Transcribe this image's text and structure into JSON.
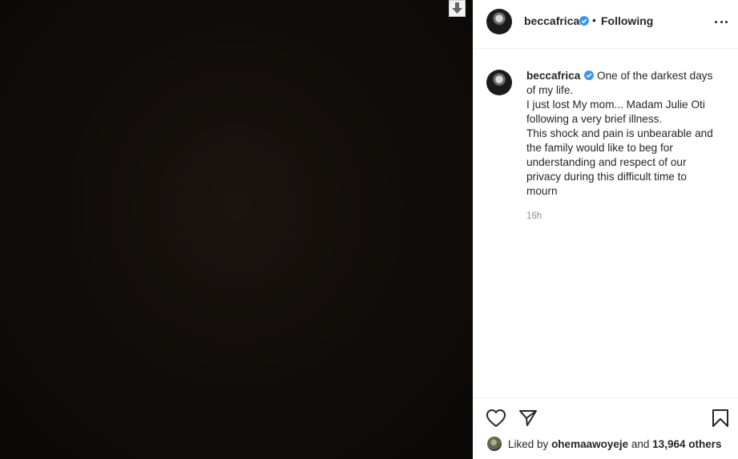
{
  "post": {
    "username": "beccafrica",
    "separator": "•",
    "follow_status": "Following",
    "caption_lines": [
      "One of the darkest days",
      "of my life.",
      "I just lost My mom... Madam Julie Oti",
      "following a very brief illness.",
      "This shock and pain is unbearable and",
      "the family would like to beg for",
      "understanding and respect of our",
      "privacy during this difficult time to",
      "mourn"
    ],
    "time_ago": "16h",
    "liked_prefix": "Liked by",
    "liked_user": "ohemaawoyeje",
    "liked_and": "and",
    "liked_others": "13,964 others"
  },
  "icons": {
    "download": "download-arrow-icon",
    "verified": "verified-badge-icon",
    "more": "more-options-icon",
    "like": "heart-icon",
    "share": "paper-plane-icon",
    "save": "bookmark-icon"
  },
  "colors": {
    "verified_blue": "#3897f0",
    "text": "#262626",
    "muted": "#8e8e8e",
    "media_bg": "#100c09"
  }
}
